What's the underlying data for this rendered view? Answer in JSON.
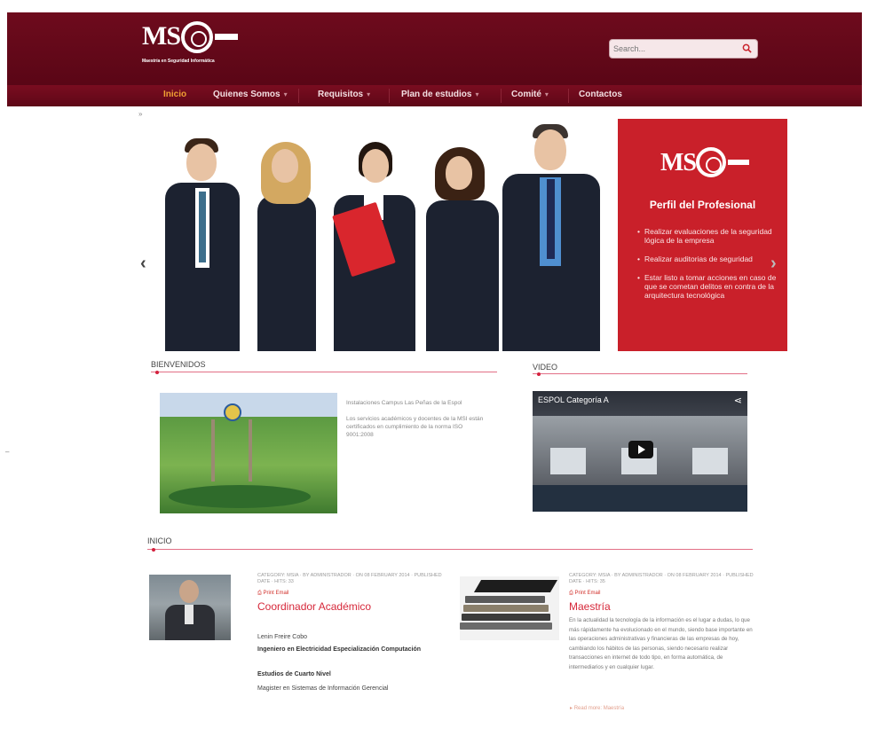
{
  "header": {
    "logo_text": "MS",
    "logo_subtitle": "Maestría en Seguridad Informática",
    "search_placeholder": "Search..."
  },
  "nav": {
    "items": [
      {
        "label": "Inicio",
        "has_caret": false,
        "active": true
      },
      {
        "label": "Quienes Somos",
        "has_caret": true,
        "active": false
      },
      {
        "label": "Requisitos",
        "has_caret": true,
        "active": false
      },
      {
        "label": "Plan de estudios",
        "has_caret": true,
        "active": false
      },
      {
        "label": "Comité",
        "has_caret": true,
        "active": false
      },
      {
        "label": "Contactos",
        "has_caret": false,
        "active": false
      }
    ]
  },
  "slider": {
    "profile": {
      "logo_text": "MS",
      "title": "Perfil del Profesional",
      "items": [
        "Realizar evaluaciones de la seguridad lógica de la empresa",
        "Realizar auditorias de seguridad",
        "Estar listo a tomar acciones en caso de que se cometan delitos en contra de la arquitectura tecnológica"
      ]
    },
    "prev_icon": "chevron-left-icon",
    "next_icon": "chevron-right-icon"
  },
  "bienvenidos": {
    "heading": "BIENVENIDOS",
    "caption": "Instalaciones Campus Las Peñas de la Espol",
    "text": "Los servicios académicos y docentes de la MSI están certificados en cumplimiento de la norma ISO 9001:2008"
  },
  "video": {
    "heading": "VIDEO",
    "title": "ESPOL Categoría A"
  },
  "inicio": {
    "heading": "INICIO",
    "articles": [
      {
        "meta": "CATEGORY: MSIA · BY ADMINISTRADOR · ON 08 FEBRUARY 2014 · PUBLISHED DATE · HITS: 33",
        "actions": "Print  Email",
        "title": "Coordinador Académico",
        "name": "Lenin Freire Cobo",
        "degree1": "Ingeniero en Electricidad Especialización Computación",
        "degree2": "Estudios de Cuarto Nivel",
        "degree3": "Magister en Sistemas de Información Gerencial"
      },
      {
        "meta": "CATEGORY: MSIA · BY ADMINISTRADOR · ON 08 FEBRUARY 2014 · PUBLISHED DATE · HITS: 35",
        "actions": "Print  Email",
        "title": "Maestría",
        "paragraph": "En la actualidad la tecnología de la información es el lugar a dudas, lo que más rápidamente ha evolucionado en el mundo, siendo base importante en las operaciones administrativas y financieras de las empresas de hoy, cambiando los hábitos de las personas, siendo necesario realizar transacciones en internet de todo tipo, en forma automática, de intermediarios y en cualquier lugar.",
        "read_more": "Read more: Maestría"
      }
    ]
  },
  "colors": {
    "header_bg": "#6e0b1d",
    "accent": "#d6283a",
    "nav_active": "#f0a033",
    "profile_bg": "#c9202a"
  }
}
